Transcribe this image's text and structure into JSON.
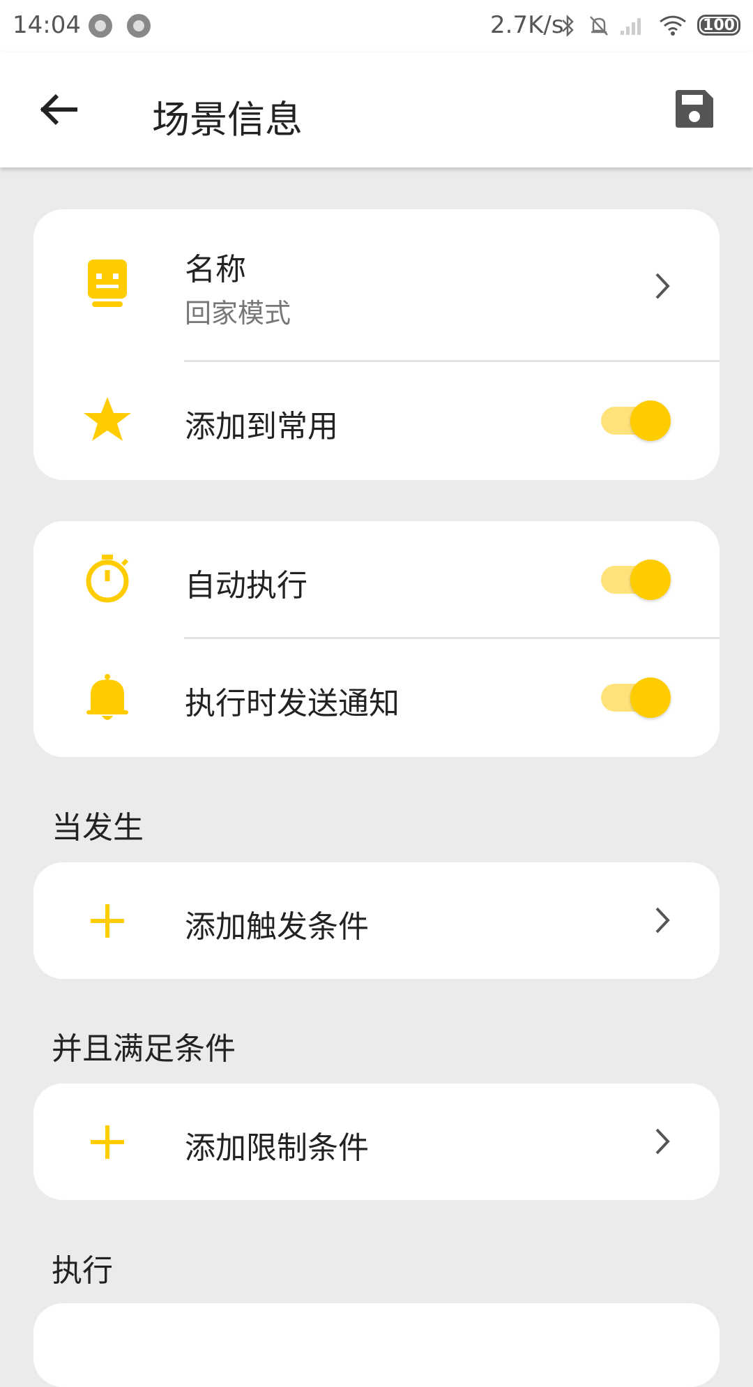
{
  "status_bar": {
    "time": "14:04",
    "network_speed": "2.7K/s",
    "battery_level": "100",
    "icons": [
      "notification-dot-icon",
      "notification-dot-icon",
      "bluetooth-icon",
      "mute-icon",
      "signal-icon",
      "wifi-icon",
      "battery-icon"
    ]
  },
  "app_bar": {
    "title": "场景信息",
    "back_icon": "arrow-left-icon",
    "save_icon": "save-icon"
  },
  "accent_color": "#FFCC00",
  "card1": {
    "name_label": "名称",
    "name_value": "回家模式",
    "favorite_label": "添加到常用",
    "favorite_enabled": true
  },
  "card2": {
    "auto_exec_label": "自动执行",
    "auto_exec_enabled": true,
    "notify_label": "执行时发送通知",
    "notify_enabled": true
  },
  "sections": {
    "trigger_title": "当发生",
    "trigger_add_label": "添加触发条件",
    "condition_title": "并且满足条件",
    "condition_add_label": "添加限制条件",
    "action_title": "执行"
  }
}
